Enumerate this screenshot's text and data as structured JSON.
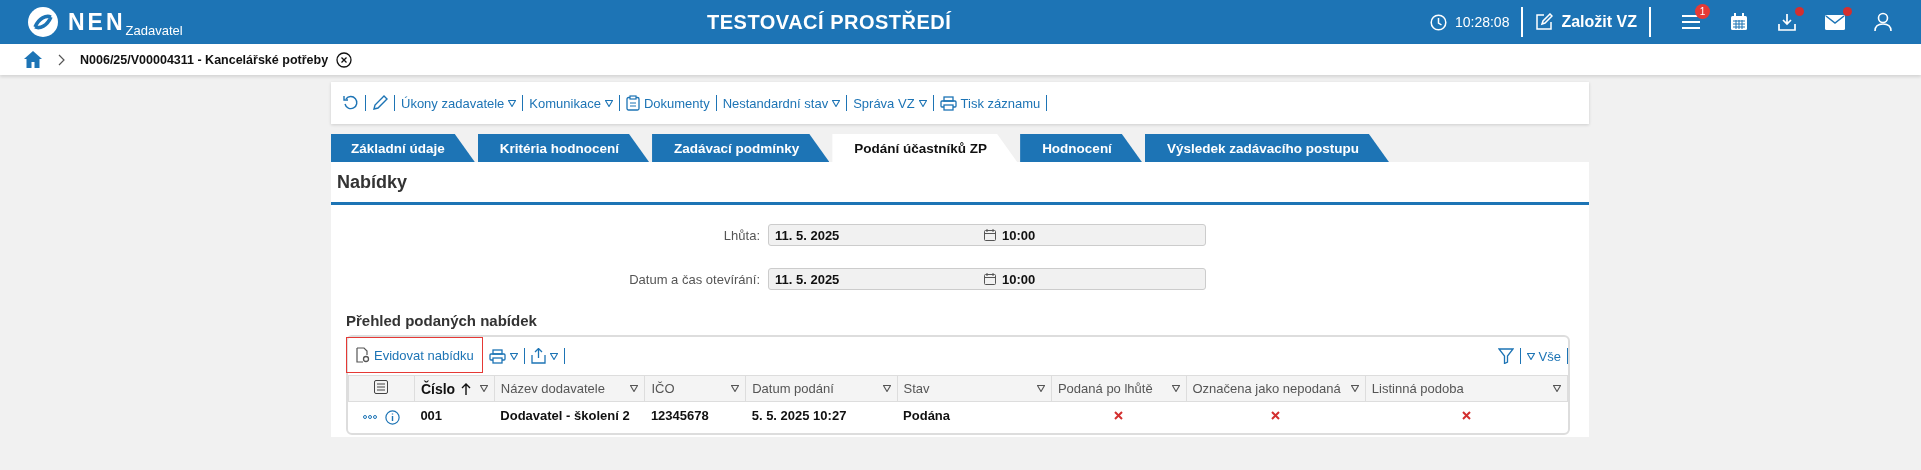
{
  "header": {
    "logo_text": "NEN",
    "subtitle": "Zadavatel",
    "environment": "TESTOVACÍ PROSTŘEDÍ",
    "time": "10:28:08",
    "create_button": "Založit VZ",
    "menu_badge": "1",
    "downloads_new": true,
    "messages_new": true
  },
  "breadcrumb": {
    "title": "N006/25/V00004311 - Kancelářské potřeby"
  },
  "toolbar": [
    {
      "kind": "menu",
      "label": "Úkony zadavatele"
    },
    {
      "kind": "menu",
      "label": "Komunikace"
    },
    {
      "kind": "link",
      "label": "Dokumenty"
    },
    {
      "kind": "menu",
      "label": "Nestandardní stav"
    },
    {
      "kind": "menu",
      "label": "Správa VZ"
    },
    {
      "kind": "link",
      "label": "Tisk záznamu"
    }
  ],
  "tabs": [
    {
      "label": "Základní údaje",
      "selected": false
    },
    {
      "label": "Kritéria hodnocení",
      "selected": false
    },
    {
      "label": "Zadávací podmínky",
      "selected": false
    },
    {
      "label": "Podání účastníků ZP",
      "selected": true
    },
    {
      "label": "Hodnocení",
      "selected": false
    },
    {
      "label": "Výsledek zadávacího postupu",
      "selected": false
    }
  ],
  "section_title": "Nabídky",
  "fields": [
    {
      "label": "Lhůta:",
      "date": "11. 5. 2025",
      "time": "10:00"
    },
    {
      "label": "Datum a čas otevírání:",
      "date": "11. 5. 2025",
      "time": "10:00"
    }
  ],
  "list_title": "Přehled podaných nabídek",
  "table_toolbar": {
    "add_button": "Evidovat nabídku",
    "add_highlighted": true,
    "filter_label": "Vše"
  },
  "columns": [
    {
      "label": "Číslo",
      "sorted": true
    },
    {
      "label": "Název dodavatele",
      "sorted": false
    },
    {
      "label": "IČO",
      "sorted": false
    },
    {
      "label": "Datum podání",
      "sorted": false
    },
    {
      "label": "Stav",
      "sorted": false
    },
    {
      "label": "Podaná po lhůtě",
      "sorted": false
    },
    {
      "label": "Označena jako nepodaná",
      "sorted": false
    },
    {
      "label": "Listinná podoba",
      "sorted": false
    }
  ],
  "rows": [
    {
      "number": "001",
      "supplier": "Dodavatel - školení 2",
      "ico": "12345678",
      "submitted": "5. 5. 2025 10:27",
      "status": "Podána",
      "late": false,
      "marked_unsubmitted": false,
      "paper": false
    }
  ]
}
